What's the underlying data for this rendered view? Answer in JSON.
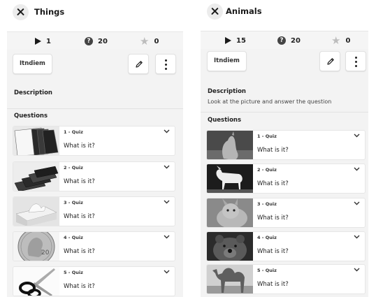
{
  "panels": [
    {
      "title": "Things",
      "stats": {
        "plays": "1",
        "questions": "20",
        "stars": "0"
      },
      "tag_label": "Itndiem",
      "description_label": "Description",
      "description_text": "",
      "questions_label": "Questions",
      "questions": [
        {
          "number": "1 - Quiz",
          "text": "What is it?",
          "thumb": "folders"
        },
        {
          "number": "2 - Quiz",
          "text": "What is it?",
          "thumb": "wallets"
        },
        {
          "number": "3 - Quiz",
          "text": "What is it?",
          "thumb": "tissue-box"
        },
        {
          "number": "4 - Quiz",
          "text": "What is it?",
          "thumb": "coin"
        },
        {
          "number": "5 - Quiz",
          "text": "What is it?",
          "thumb": "scissors"
        }
      ]
    },
    {
      "title": "Animals",
      "stats": {
        "plays": "15",
        "questions": "20",
        "stars": "0"
      },
      "tag_label": "Itndiem",
      "description_label": "Description",
      "description_text": "Look at the picture and answer the question",
      "questions_label": "Questions",
      "questions": [
        {
          "number": "1 - Quiz",
          "text": "What is it?",
          "thumb": "kangaroo"
        },
        {
          "number": "2 - Quiz",
          "text": "What is it?",
          "thumb": "goat"
        },
        {
          "number": "3 - Quiz",
          "text": "What is it?",
          "thumb": "rabbit"
        },
        {
          "number": "4 - Quiz",
          "text": "What is it?",
          "thumb": "bear"
        },
        {
          "number": "5 - Quiz",
          "text": "What is it?",
          "thumb": "camel"
        }
      ]
    }
  ],
  "icons": {
    "close": "close-icon",
    "play": "play-icon",
    "help": "help-icon",
    "star": "star-icon",
    "edit": "pencil-icon",
    "more": "more-vertical-icon",
    "expand": "chevron-down-icon"
  },
  "colors": {
    "star": "#bdbdbd",
    "content_bg": "#f3f3f3",
    "stats_bg": "#f5f5f5"
  }
}
